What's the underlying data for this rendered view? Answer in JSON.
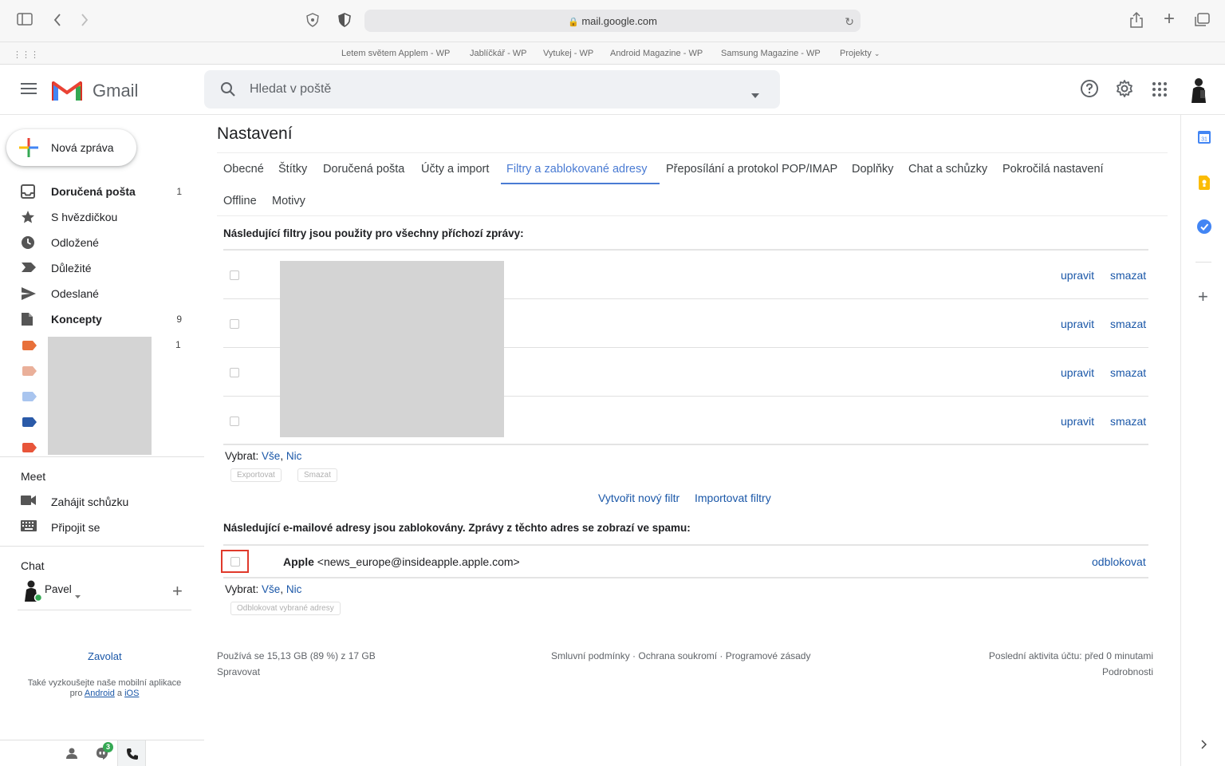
{
  "browser": {
    "url": "mail.google.com",
    "bookmarks": [
      "Letem světem Applem - WP",
      "Jablíčkář - WP",
      "Vytukej - WP",
      "Android Magazine - WP",
      "Samsung Magazine - WP",
      "Projekty"
    ]
  },
  "header": {
    "app_name": "Gmail",
    "search_placeholder": "Hledat v poště"
  },
  "sidebar": {
    "compose_label": "Nová zpráva",
    "items": [
      {
        "label": "Doručená pošta",
        "count": "1",
        "icon": "inbox-icon",
        "bold": true
      },
      {
        "label": "S hvězdičkou",
        "count": "",
        "icon": "star-icon",
        "bold": false
      },
      {
        "label": "Odložené",
        "count": "",
        "icon": "clock-icon",
        "bold": false
      },
      {
        "label": "Důležité",
        "count": "",
        "icon": "important-icon",
        "bold": false
      },
      {
        "label": "Odeslané",
        "count": "",
        "icon": "send-icon",
        "bold": false
      },
      {
        "label": "Koncepty",
        "count": "9",
        "icon": "draft-icon",
        "bold": true
      }
    ],
    "label_count": "1",
    "label_colors": [
      "#e8703a",
      "#eab09a",
      "#a9c5ef",
      "#2a5aa8",
      "#e8553a"
    ],
    "meet": {
      "title": "Meet",
      "items": [
        {
          "label": "Zahájit schůzku",
          "icon": "video-icon"
        },
        {
          "label": "Připojit se",
          "icon": "keyboard-icon"
        }
      ]
    },
    "chat": {
      "title": "Chat",
      "user": "Pavel"
    },
    "call_link": "Zavolat",
    "mobile_text_1": "Také vyzkoušejte naše mobilní aplikace",
    "mobile_text_pro": "pro",
    "mobile_android": "Android",
    "mobile_a": "a",
    "mobile_ios": "iOS",
    "bottom_badge": "3"
  },
  "settings": {
    "title": "Nastavení",
    "tabs_row1": [
      "Obecné",
      "Štítky",
      "Doručená pošta",
      "Účty a import",
      "Filtry a zablokované adresy",
      "Přeposílání a protokol POP/IMAP",
      "Doplňky",
      "Chat a schůzky",
      "Pokročilá nastavení"
    ],
    "tabs_row2": [
      "Offline",
      "Motivy"
    ],
    "active_tab": "Filtry a zablokované adresy",
    "filters_heading": "Následující filtry jsou použity pro všechny příchozí zprávy:",
    "filter_rows": [
      {
        "edit": "upravit",
        "delete": "smazat"
      },
      {
        "edit": "upravit",
        "delete": "smazat"
      },
      {
        "edit": "upravit",
        "delete": "smazat"
      },
      {
        "edit": "upravit",
        "delete": "smazat"
      }
    ],
    "select_label": "Vybrat:",
    "select_all": "Vše",
    "select_none": "Nic",
    "export_btn": "Exportovat",
    "delete_btn": "Smazat",
    "create_filter": "Vytvořit nový filtr",
    "import_filters": "Importovat filtry",
    "blocked_heading": "Následující e-mailové adresy jsou zablokovány. Zprávy z těchto adres se zobrazí ve spamu:",
    "blocked": [
      {
        "name": "Apple",
        "email": "<news_europe@insideapple.apple.com>",
        "action": "odblokovat"
      }
    ],
    "unblock_selected_btn": "Odblokovat vybrané adresy"
  },
  "footer": {
    "storage": "Používá se 15,13 GB (89 %) z 17 GB",
    "manage": "Spravovat",
    "links": "Smluvní podmínky · Ochrana soukromí · Programové zásady",
    "last_activity": "Poslední aktivita účtu: před 0 minutami",
    "details": "Podrobnosti"
  },
  "side_panel": {
    "calendar_day": "31"
  }
}
